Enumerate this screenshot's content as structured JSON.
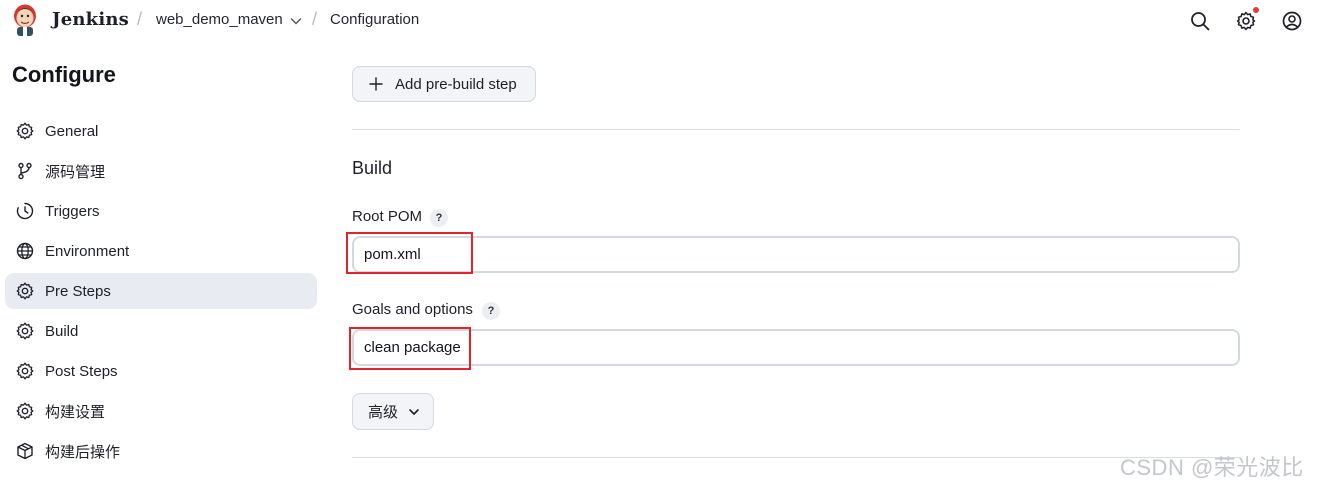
{
  "header": {
    "brand": "Jenkins",
    "breadcrumb": [
      "web_demo_maven",
      "Configuration"
    ],
    "separator": "/"
  },
  "sidebar": {
    "title": "Configure",
    "items": [
      {
        "label": "General",
        "icon": "gear-icon"
      },
      {
        "label": "源码管理",
        "icon": "branch-icon"
      },
      {
        "label": "Triggers",
        "icon": "clock-icon"
      },
      {
        "label": "Environment",
        "icon": "globe-icon"
      },
      {
        "label": "Pre Steps",
        "icon": "gear-icon",
        "active": true
      },
      {
        "label": "Build",
        "icon": "gear-icon"
      },
      {
        "label": "Post Steps",
        "icon": "gear-icon"
      },
      {
        "label": "构建设置",
        "icon": "gear-icon"
      },
      {
        "label": "构建后操作",
        "icon": "cube-icon"
      }
    ]
  },
  "main": {
    "add_prebuild_label": "Add pre-build step",
    "build_section_title": "Build",
    "root_pom": {
      "label": "Root POM",
      "help": "?",
      "value": "pom.xml"
    },
    "goals": {
      "label": "Goals and options",
      "help": "?",
      "value": "clean package"
    },
    "advanced_label": "高级"
  },
  "colors": {
    "active_item_bg": "#e8ebf1",
    "highlight_border": "#e0242b",
    "notification_dot": "#e5393b"
  },
  "watermark": "CSDN @荣光波比"
}
